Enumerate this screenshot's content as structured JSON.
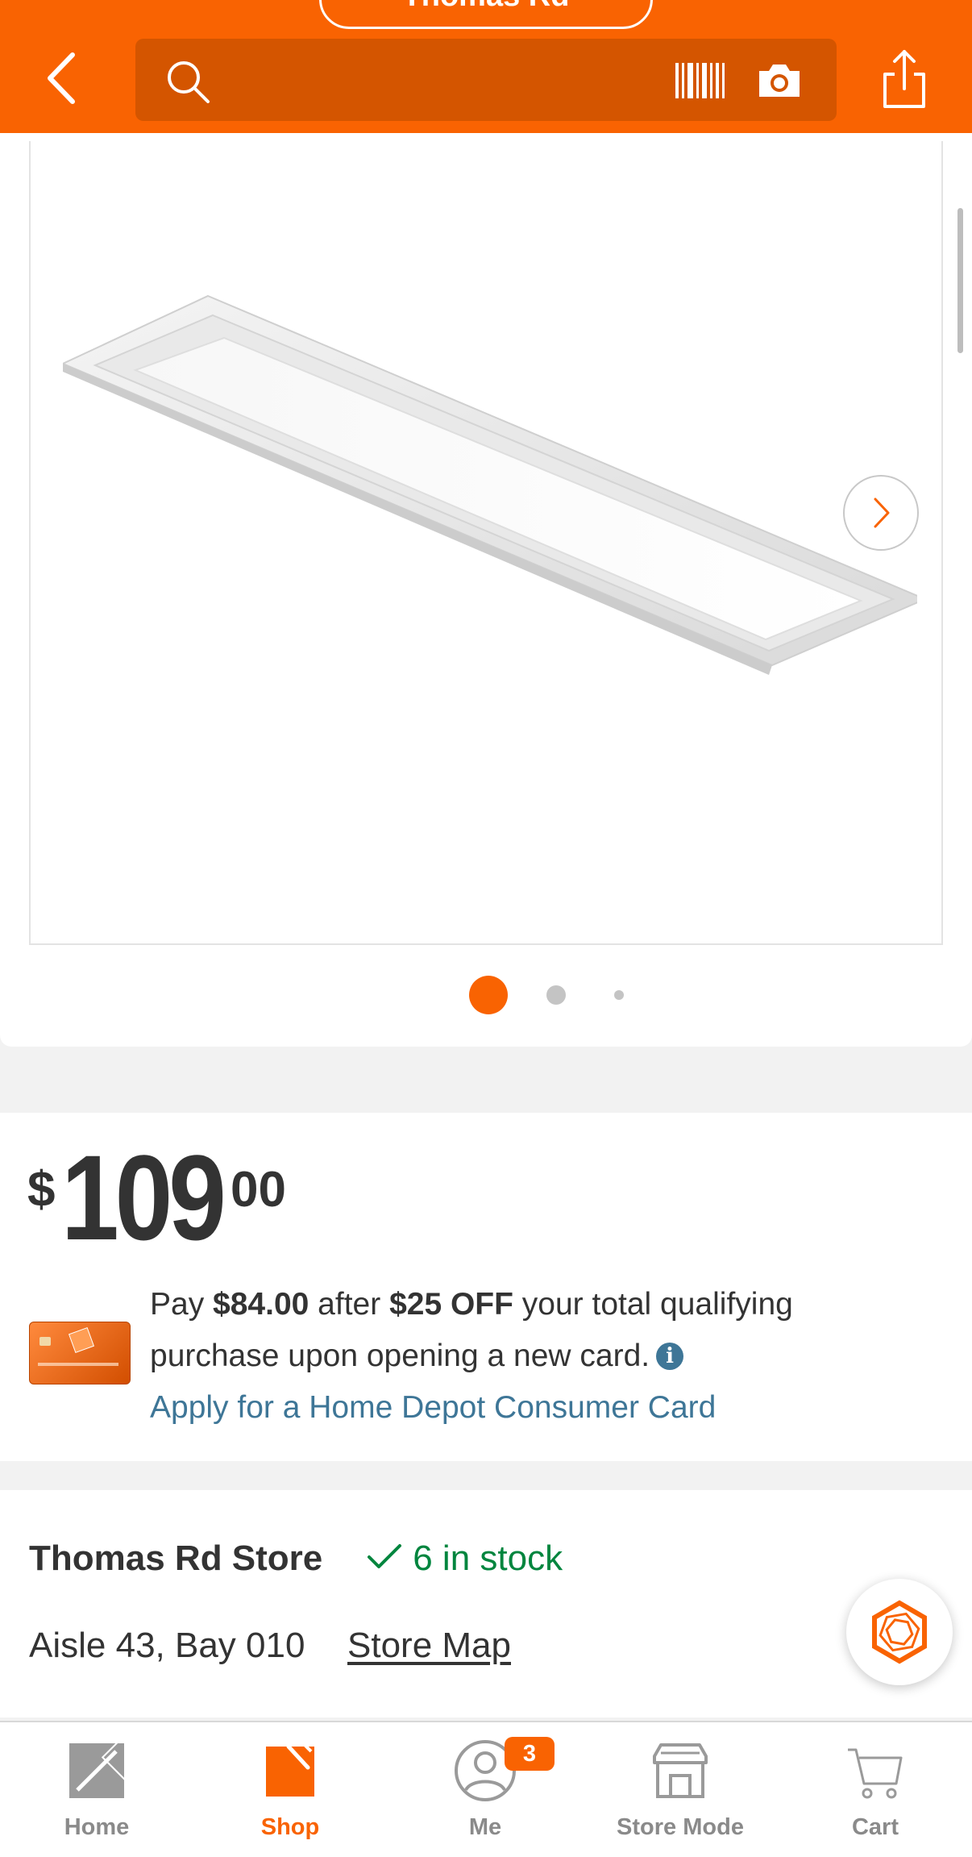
{
  "header": {
    "store_selector": "Thomas Rd",
    "search_placeholder": "",
    "colors": {
      "brand": "#f96302",
      "search_bg": "#d45500"
    }
  },
  "gallery": {
    "image_count": 3,
    "active_index": 0
  },
  "price": {
    "currency": "$",
    "dollars": "109",
    "cents": "00"
  },
  "promo": {
    "pay_prefix": "Pay ",
    "pay_amount": "$84.00",
    "after": " after ",
    "discount": "$25 OFF",
    "rest": " your total qualifying purchase upon opening a new card.",
    "info_icon": "i",
    "apply_link": "Apply for a Home Depot Consumer Card"
  },
  "store": {
    "name": "Thomas Rd Store",
    "stock": "6 in stock",
    "aisle": "Aisle 43, Bay 010",
    "map_link": "Store Map"
  },
  "nav": {
    "items": [
      {
        "label": "Home",
        "icon": "home-depot-logo-icon"
      },
      {
        "label": "Shop",
        "icon": "shop-icon",
        "active": true
      },
      {
        "label": "Me",
        "icon": "person-icon",
        "badge": "3"
      },
      {
        "label": "Store Mode",
        "icon": "store-icon"
      },
      {
        "label": "Cart",
        "icon": "cart-icon"
      }
    ]
  }
}
